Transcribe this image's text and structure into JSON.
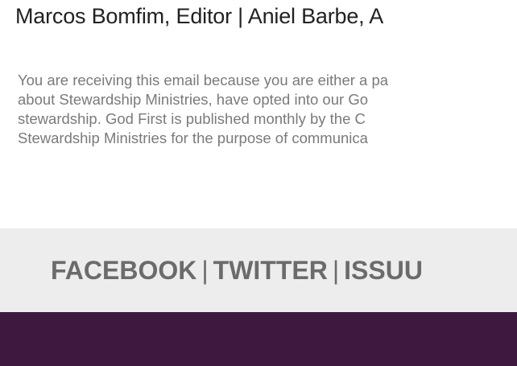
{
  "credits": {
    "text": "Marcos Bomfim, Editor | Aniel Barbe, A"
  },
  "notice": {
    "lines": [
      "You are receiving this email because you are either a pa",
      "about Stewardship Ministries, have opted into our Go",
      "stewardship. God First is published monthly by the C",
      "Stewardship Ministries for the purpose of communica"
    ]
  },
  "social": {
    "facebook": "FACEBOOK",
    "twitter": "TWITTER",
    "issuu": "ISSUU",
    "separator": "|"
  },
  "colors": {
    "footer_band": "#3f1840",
    "social_bar": "#ededed",
    "social_text": "#6b6b6b",
    "notice_text": "#7a7a7a"
  }
}
